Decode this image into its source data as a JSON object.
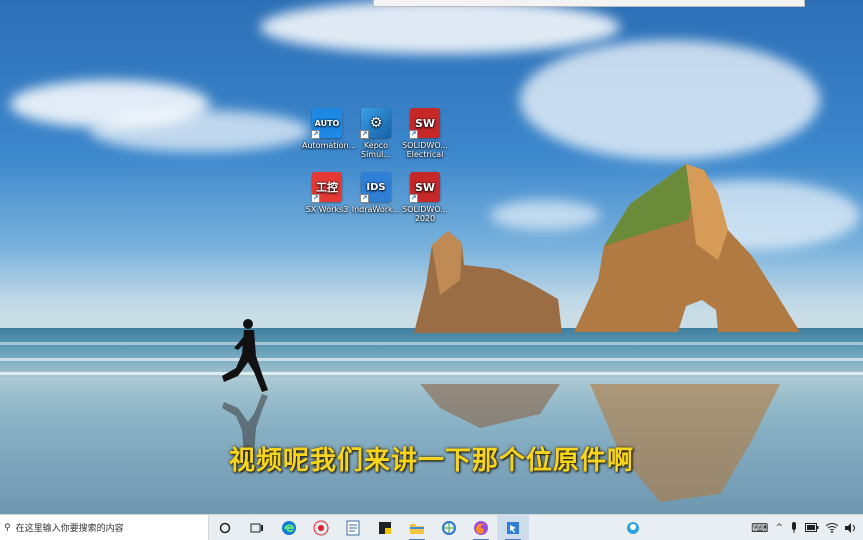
{
  "subtitle": "视频呢我们来讲一下那个位原件啊",
  "desktop": {
    "icons": [
      {
        "name": "AUTO",
        "label": "Automation..."
      },
      {
        "name": "",
        "label": "Kepco Simul..."
      },
      {
        "name": "SW",
        "label": "SOLIDWO... Electrical"
      },
      {
        "name": "工控",
        "label": "SX Works3"
      },
      {
        "name": "IDS",
        "label": "IndraWork..."
      },
      {
        "name": "SW",
        "label": "SOLIDWO... 2020"
      }
    ]
  },
  "taskbar": {
    "search_placeholder": "在这里输入你要搜索的内容",
    "search_icon": "magnifier-icon",
    "apps": [
      "task-view-icon",
      "edge-icon",
      "app-icon",
      "notepad-icon",
      "sticky-icon",
      "explorer-icon",
      "network-icon",
      "firefox-icon",
      "app-selected-icon"
    ],
    "tray": {
      "keyboard": "⌨",
      "chevron": "^"
    }
  },
  "colors": {
    "subtitle": "#f7d51d",
    "taskbar": "#e9eef2",
    "sky_top": "#2c6fb6"
  }
}
